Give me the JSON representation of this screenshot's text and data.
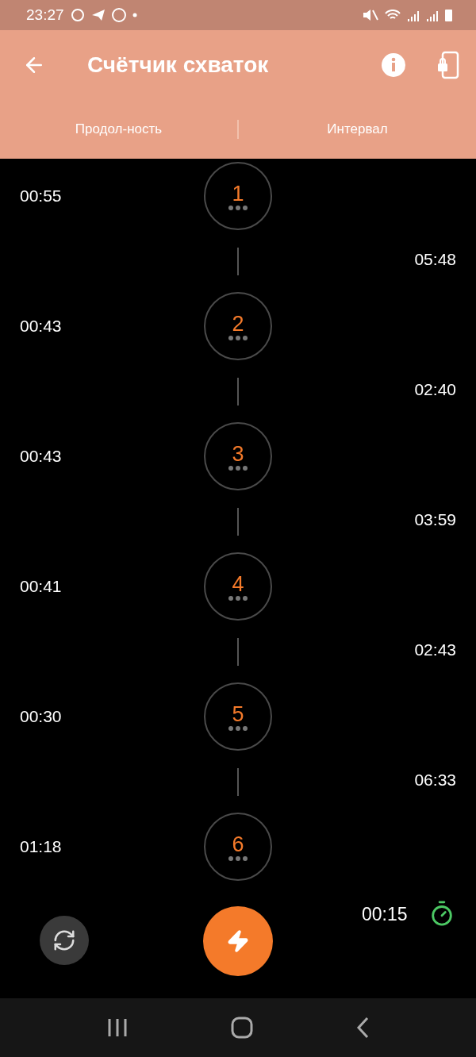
{
  "status_bar": {
    "time": "23:27"
  },
  "app_bar": {
    "title": "Счётчик схваток"
  },
  "columns": [
    {
      "label": "Продол-ность"
    },
    {
      "label": "Интервал"
    }
  ],
  "contractions": [
    {
      "number": "1",
      "duration": "00:55",
      "interval": "05:48"
    },
    {
      "number": "2",
      "duration": "00:43",
      "interval": "02:40"
    },
    {
      "number": "3",
      "duration": "00:43",
      "interval": "03:59"
    },
    {
      "number": "4",
      "duration": "00:41",
      "interval": "02:43"
    },
    {
      "number": "5",
      "duration": "00:30",
      "interval": "06:33"
    },
    {
      "number": "6",
      "duration": "01:18"
    }
  ],
  "timer": {
    "elapsed": "00:15"
  }
}
